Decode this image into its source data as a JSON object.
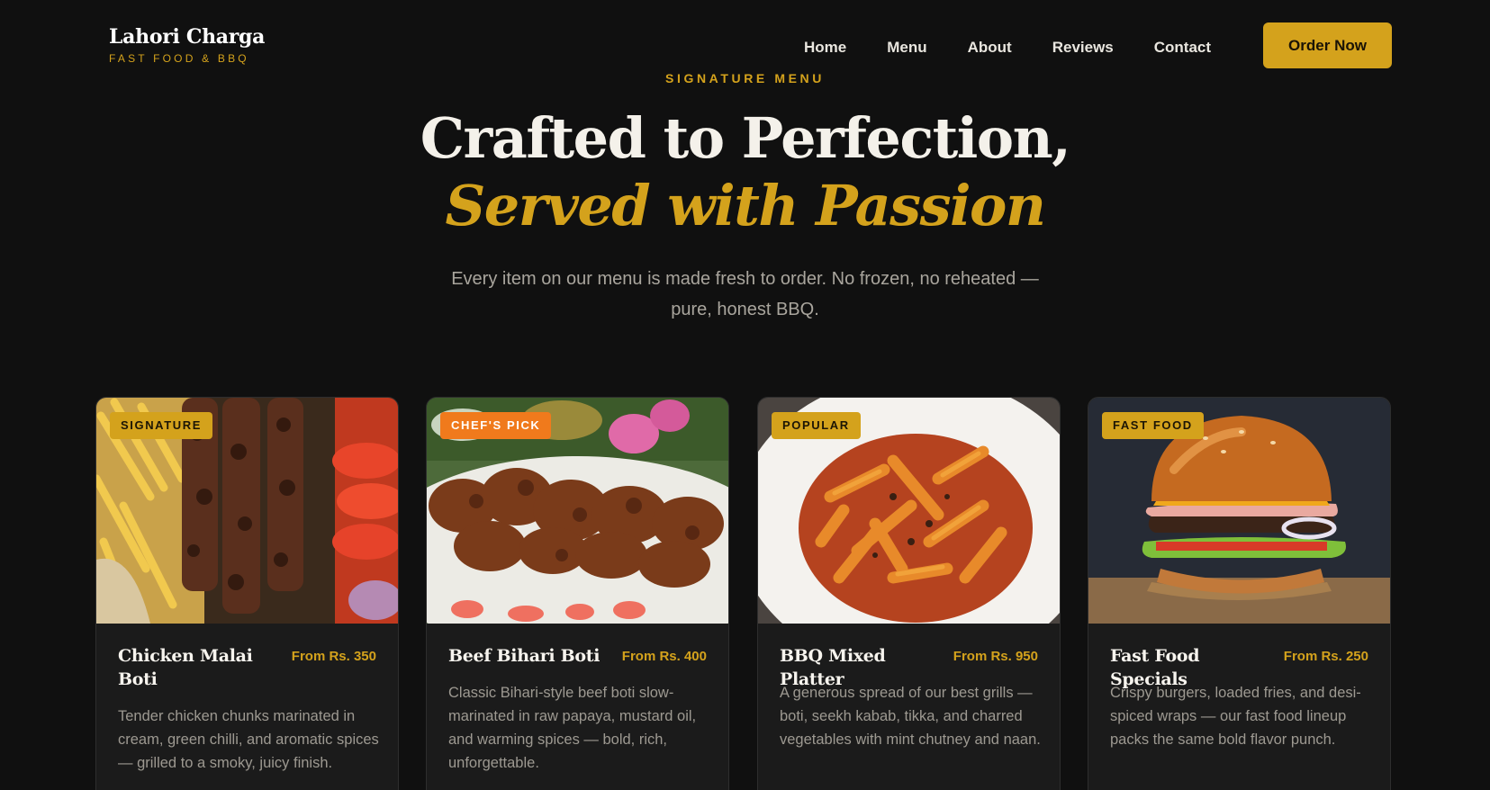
{
  "brand": {
    "name": "Lahori Charga",
    "tagline": "FAST FOOD & BBQ"
  },
  "nav": {
    "items": [
      "Home",
      "Menu",
      "About",
      "Reviews",
      "Contact"
    ],
    "cta": "Order Now"
  },
  "hero": {
    "eyebrow": "SIGNATURE MENU",
    "title_line1": "Crafted to Perfection,",
    "title_line2": "Served with Passion",
    "subtitle": "Every item on our menu is made fresh to order. No frozen, no reheated — pure, honest BBQ."
  },
  "menu": [
    {
      "badge": "SIGNATURE",
      "name": "Chicken Malai Boti",
      "price": "From Rs. 350",
      "description": "Tender chicken chunks marinated in cream, green chilli, and aromatic spices — grilled to a smoky, juicy finish."
    },
    {
      "badge": "CHEF'S PICK",
      "name": "Beef Bihari Boti",
      "price": "From Rs. 400",
      "description": "Classic Bihari-style beef boti slow-marinated in raw papaya, mustard oil, and warming spices — bold, rich, unforgettable."
    },
    {
      "badge": "POPULAR",
      "name": "BBQ Mixed Platter",
      "price": "From Rs. 950",
      "description": "A generous spread of our best grills — boti, seekh kabab, tikka, and charred vegetables with mint chutney and naan."
    },
    {
      "badge": "FAST FOOD",
      "name": "Fast Food Specials",
      "price": "From Rs. 250",
      "description": "Crispy burgers, loaded fries, and desi-spiced wraps — our fast food lineup packs the same bold flavor punch."
    }
  ],
  "colors": {
    "accent": "#d4a21c",
    "badge_orange": "#f07a1c",
    "background": "#101010",
    "card": "#1b1b1b"
  }
}
